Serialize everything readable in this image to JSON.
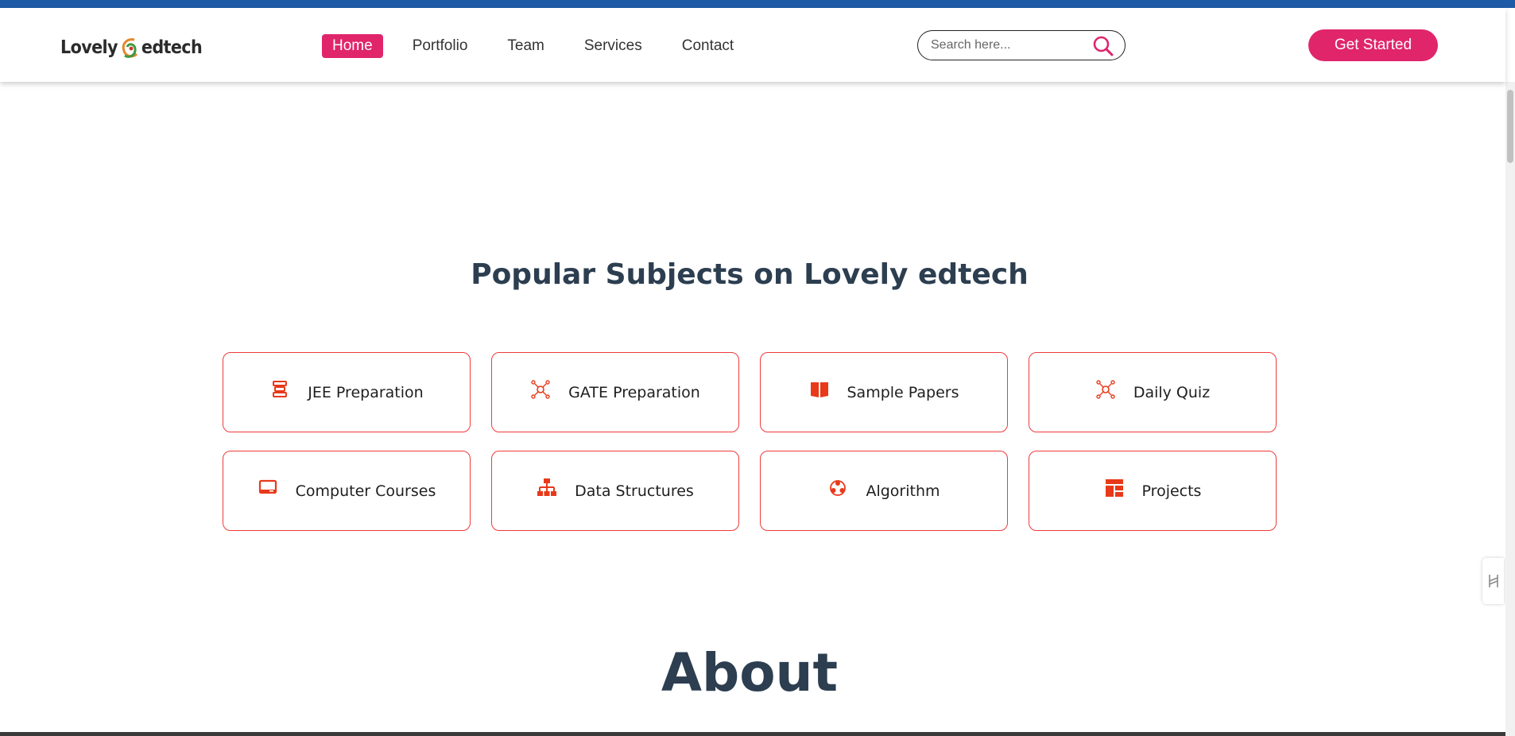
{
  "header": {
    "logo": {
      "left": "Lovely",
      "right": "edtech"
    },
    "nav": [
      {
        "label": "Home",
        "active": true
      },
      {
        "label": "Portfolio",
        "active": false
      },
      {
        "label": "Team",
        "active": false
      },
      {
        "label": "Services",
        "active": false
      },
      {
        "label": "Contact",
        "active": false
      }
    ],
    "search": {
      "placeholder": "Search here...",
      "value": ""
    },
    "cta_label": "Get Started"
  },
  "subjects": {
    "title": "Popular Subjects on Lovely edtech",
    "items": [
      {
        "label": "JEE Preparation",
        "icon": "stack-icon"
      },
      {
        "label": "GATE Preparation",
        "icon": "network-icon"
      },
      {
        "label": "Sample Papers",
        "icon": "book-icon"
      },
      {
        "label": "Daily Quiz",
        "icon": "network-icon"
      },
      {
        "label": "Computer Courses",
        "icon": "laptop-icon"
      },
      {
        "label": "Data Structures",
        "icon": "sitemap-icon"
      },
      {
        "label": "Algorithm",
        "icon": "cluster-icon"
      },
      {
        "label": "Projects",
        "icon": "layout-icon"
      }
    ]
  },
  "about": {
    "title": "About"
  },
  "colors": {
    "accent": "#e0256b",
    "card_border": "#ee3b3b",
    "icon": "#e8391a",
    "heading": "#2c3e50",
    "top_strip": "#1f5aa6"
  }
}
